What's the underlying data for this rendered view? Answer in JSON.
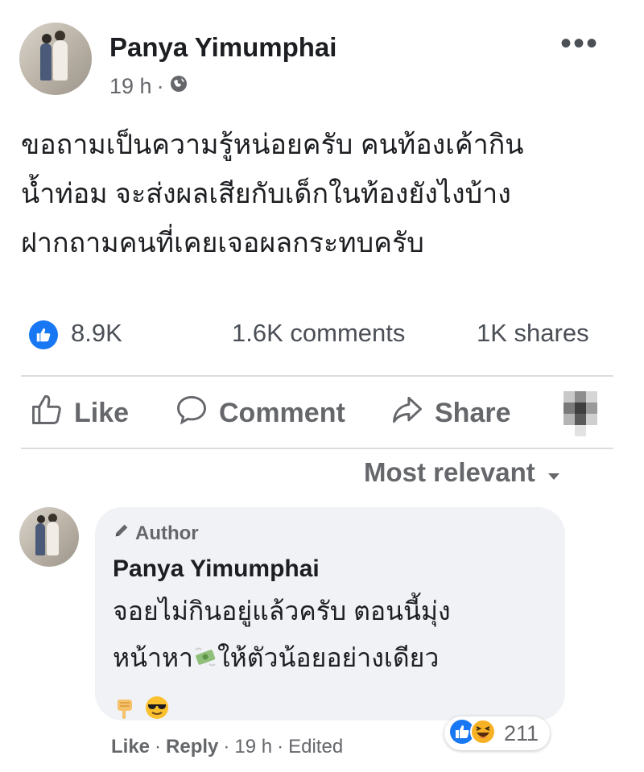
{
  "post": {
    "author": "Panya Yimumphai",
    "time": "19 h",
    "meta_separator": "·",
    "privacy_icon": "globe-icon",
    "more_label": "•••",
    "text_lines": [
      "ขอถามเป็นความรู้หน่อยครับ คนท้องเค้ากิน",
      "น้ำท่อม จะส่งผลเสียกับเด็กในท้องยังไงบ้าง",
      "ฝากถามคนที่เคยเจอผลกระทบครับ"
    ],
    "stats": {
      "likes": "8.9K",
      "comments": "1.6K comments",
      "shares": "1K shares"
    },
    "actions": {
      "like": "Like",
      "comment": "Comment",
      "share": "Share"
    }
  },
  "comments": {
    "sort_label": "Most relevant",
    "items": [
      {
        "badge": "Author",
        "author": "Panya Yimumphai",
        "line1": "จอยไม่กินอยู่แล้วครับ ตอนนี้มุ่ง",
        "line2_a": "หน้าหา",
        "line2_b": "ให้ตัวน้อยอย่างเดียว",
        "reaction_count": "211",
        "like_label": "Like",
        "reply_label": "Reply",
        "sep": "·",
        "time": "19 h",
        "edited_label": "Edited"
      }
    ]
  },
  "colors": {
    "accent_blue": "#1877f2",
    "text_primary": "#1c1e21",
    "text_secondary": "#65676b",
    "bubble_bg": "#f0f2f5",
    "divider": "#dadde1",
    "haha_yellow": "#f7b125"
  }
}
